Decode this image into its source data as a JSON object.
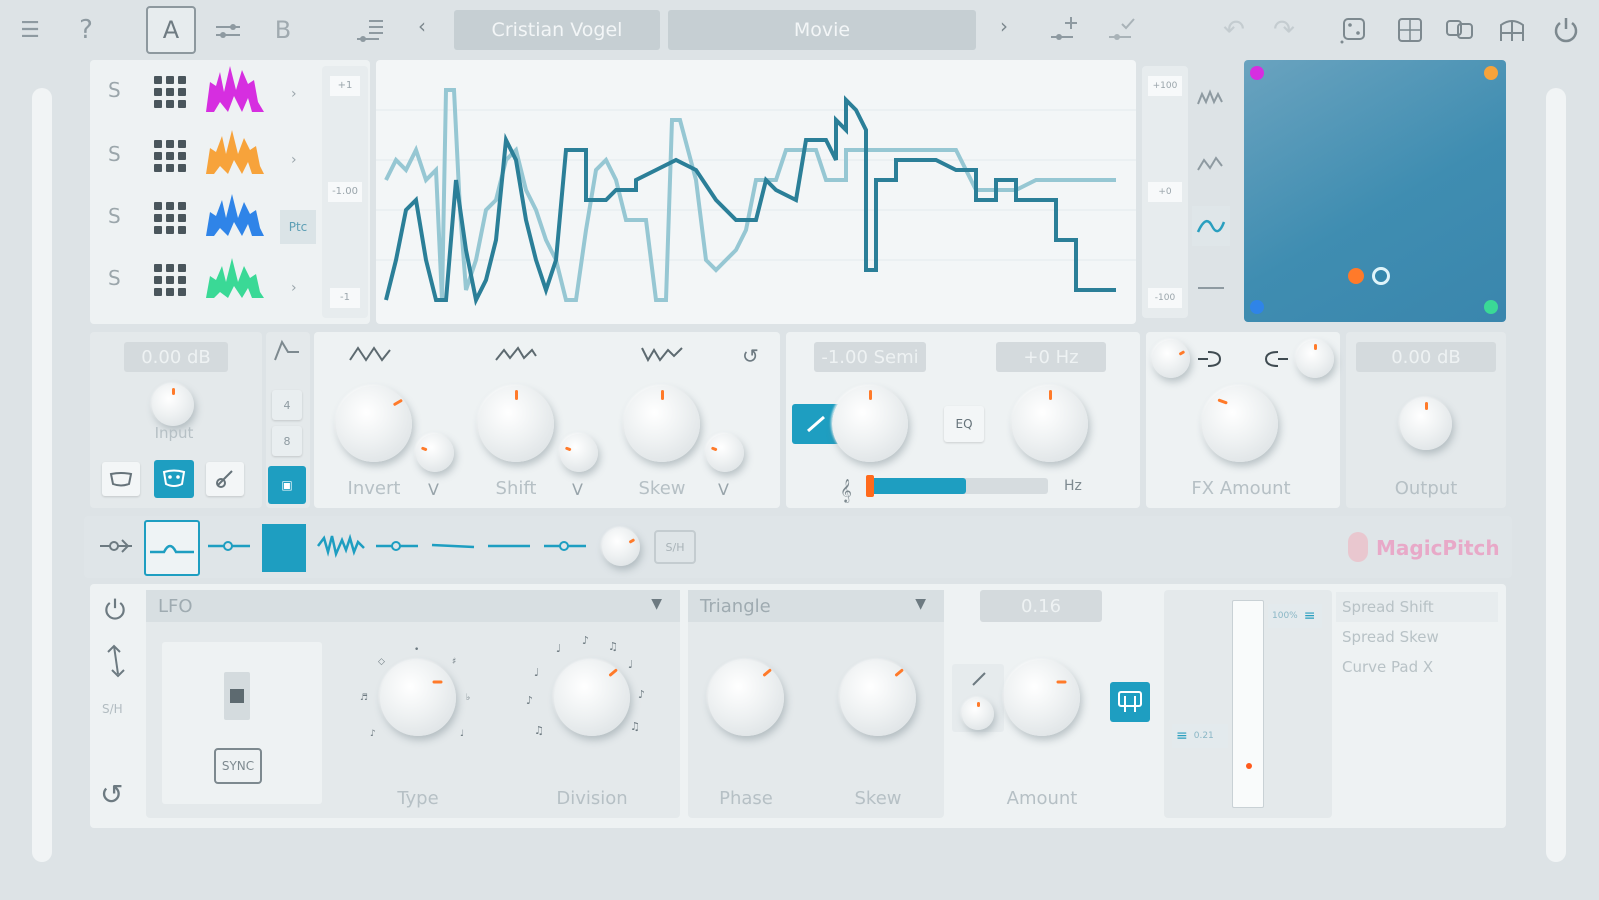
{
  "topbar": {
    "ab_a": "A",
    "ab_b": "B",
    "preset_author": "Cristian Vogel",
    "preset_name": "Movie",
    "nav_prev": "‹",
    "nav_next": "›"
  },
  "sources": {
    "letters": [
      "S",
      "S",
      "S",
      "S"
    ],
    "side_badges": [
      "›",
      "›",
      "Ptc",
      "›"
    ],
    "colors": [
      "#d62ee0",
      "#f7a33b",
      "#2f84e8",
      "#3ad996"
    ]
  },
  "scope": {
    "left_scale": [
      "+1",
      "-1.00",
      "-1"
    ],
    "right_scale": [
      "+100",
      "+0",
      "-100"
    ],
    "colors": {
      "dark": "#2b7f98",
      "light": "#96c7d3"
    }
  },
  "xy_pad": {
    "background": "#3f8db1"
  },
  "input": {
    "readout": "0.00 dB",
    "label": "Input"
  },
  "shape": {
    "invert_label": "Invert",
    "shift_label": "Shift",
    "skew_label": "Skew",
    "v": "V"
  },
  "pitch": {
    "semi_readout": "-1.00 Semi",
    "hz_readout": "+0 Hz",
    "hz_unit": "Hz",
    "slider_fill": 0.55
  },
  "fx": {
    "label": "FX Amount"
  },
  "output": {
    "readout": "0.00 dB",
    "label": "Output"
  },
  "strip": {
    "sh_label": "S/H",
    "brand": "MagicPitch"
  },
  "mod": {
    "source_dropdown": "LFO",
    "wave_dropdown": "Triangle",
    "amount_readout": "0.16",
    "type_label": "Type",
    "division_label": "Division",
    "phase_label": "Phase",
    "skew_label": "Skew",
    "amount_label": "Amount",
    "sync_label": "SYNC",
    "sh_label": "S/H",
    "pct_label": "100%",
    "small_readout": "0.21",
    "targets": [
      "Spread Shift",
      "Spread Skew",
      "Curve Pad X"
    ]
  },
  "accent": "#1e9ec1",
  "indicator": "#ff7a2a"
}
